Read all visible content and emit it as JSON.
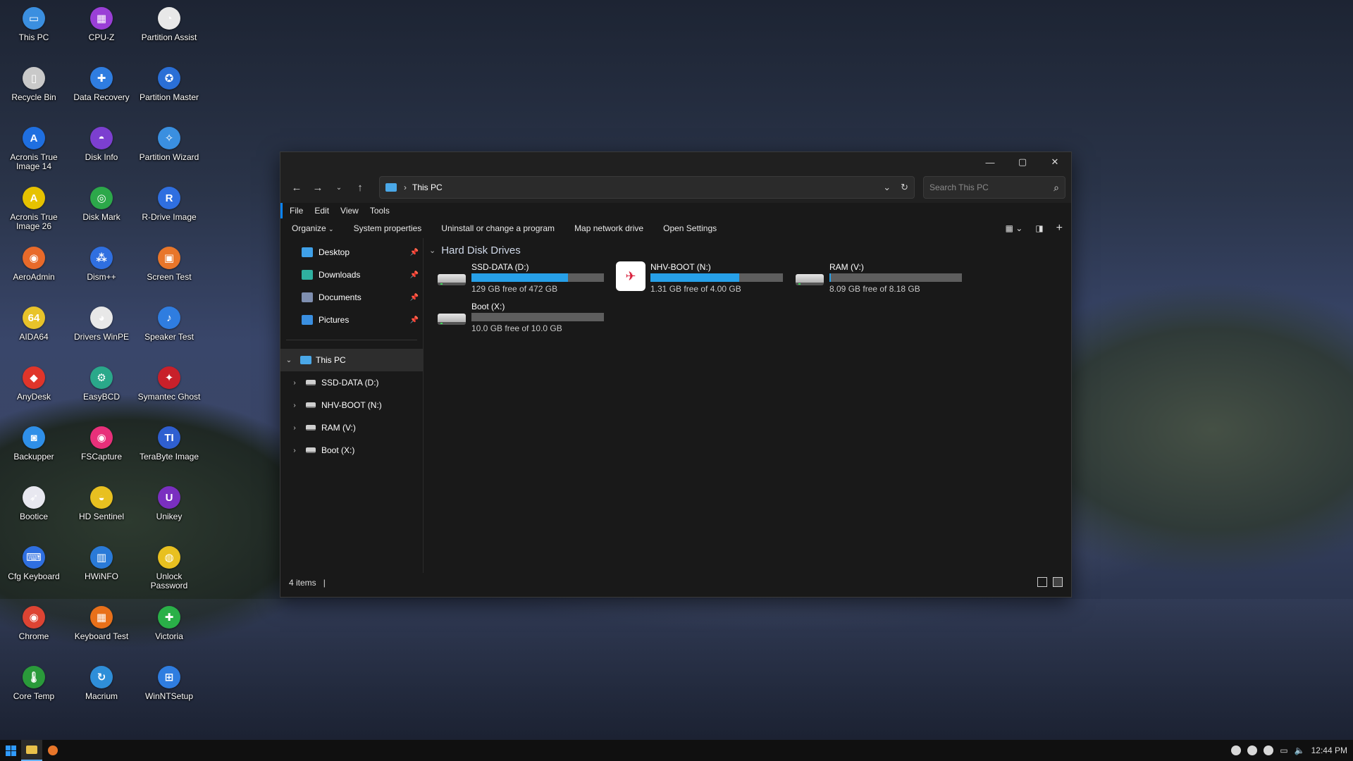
{
  "desktop": {
    "icons": [
      {
        "label": "This PC",
        "color": "#3b8fe0",
        "glyph": "▭"
      },
      {
        "label": "CPU-Z",
        "color": "#9a3fd6",
        "glyph": "▦"
      },
      {
        "label": "Partition Assist",
        "color": "#e8e8e8",
        "glyph": "◔"
      },
      {
        "label": "Recycle Bin",
        "color": "#c9c9c9",
        "glyph": "▯"
      },
      {
        "label": "Data Recovery",
        "color": "#2f7de0",
        "glyph": "✚"
      },
      {
        "label": "Partition Master",
        "color": "#2a6fd6",
        "glyph": "✪"
      },
      {
        "label": "Acronis True Image 14",
        "color": "#1f6fe0",
        "glyph": "A"
      },
      {
        "label": "Disk Info",
        "color": "#7c3fd0",
        "glyph": "◓"
      },
      {
        "label": "Partition Wizard",
        "color": "#3a8fe0",
        "glyph": "✧"
      },
      {
        "label": "Acronis True Image 26",
        "color": "#e6c200",
        "glyph": "A"
      },
      {
        "label": "Disk Mark",
        "color": "#2ca84a",
        "glyph": "◎"
      },
      {
        "label": "R-Drive Image",
        "color": "#2f6fe0",
        "glyph": "R"
      },
      {
        "label": "AeroAdmin",
        "color": "#e86a2a",
        "glyph": "◉"
      },
      {
        "label": "Dism++",
        "color": "#2f6fe0",
        "glyph": "⁂"
      },
      {
        "label": "Screen Test",
        "color": "#e8762a",
        "glyph": "▣"
      },
      {
        "label": "AIDA64",
        "color": "#e8c32a",
        "glyph": "64"
      },
      {
        "label": "Drivers WinPE",
        "color": "#e8e8e8",
        "glyph": "◕"
      },
      {
        "label": "Speaker Test",
        "color": "#2f7de0",
        "glyph": "♪"
      },
      {
        "label": "AnyDesk",
        "color": "#e0352a",
        "glyph": "◆"
      },
      {
        "label": "EasyBCD",
        "color": "#2aa88a",
        "glyph": "⚙"
      },
      {
        "label": "Symantec Ghost",
        "color": "#c8202a",
        "glyph": "✦"
      },
      {
        "label": "Backupper",
        "color": "#2f8fe8",
        "glyph": "◙"
      },
      {
        "label": "FSCapture",
        "color": "#e8307a",
        "glyph": "◉"
      },
      {
        "label": "TeraByte Image",
        "color": "#2f5fd0",
        "glyph": "TI"
      },
      {
        "label": "Bootice",
        "color": "#e8e8f0",
        "glyph": "➶"
      },
      {
        "label": "HD Sentinel",
        "color": "#e8c020",
        "glyph": "◒"
      },
      {
        "label": "Unikey",
        "color": "#7a2fc0",
        "glyph": "U"
      },
      {
        "label": "Cfg Keyboard",
        "color": "#2f6fe0",
        "glyph": "⌨"
      },
      {
        "label": "HWiNFO",
        "color": "#2a7ad8",
        "glyph": "▥"
      },
      {
        "label": "Unlock Password",
        "color": "#e8c020",
        "glyph": "◍"
      },
      {
        "label": "Chrome",
        "color": "#dd4433",
        "glyph": "◉"
      },
      {
        "label": "Keyboard Test",
        "color": "#e8701a",
        "glyph": "▦"
      },
      {
        "label": "Victoria",
        "color": "#2ab048",
        "glyph": "✚"
      },
      {
        "label": "Core Temp",
        "color": "#2a9a3a",
        "glyph": "🌡"
      },
      {
        "label": "Macrium",
        "color": "#2f8ed8",
        "glyph": "↻"
      },
      {
        "label": "WinNTSetup",
        "color": "#2f7de0",
        "glyph": "⊞"
      }
    ]
  },
  "explorer": {
    "address": {
      "path": "This PC"
    },
    "search": {
      "placeholder": "Search This PC"
    },
    "menu": [
      "File",
      "Edit",
      "View",
      "Tools"
    ],
    "commands": [
      "Organize",
      "System properties",
      "Uninstall or change a program",
      "Map network drive",
      "Open Settings"
    ],
    "quick_access": [
      {
        "label": "Desktop",
        "color": "#3fa0e8"
      },
      {
        "label": "Downloads",
        "color": "#2fb0a0"
      },
      {
        "label": "Documents",
        "color": "#7f8fb0"
      },
      {
        "label": "Pictures",
        "color": "#3a8fe0"
      }
    ],
    "tree": {
      "root": "This PC",
      "children": [
        "SSD-DATA (D:)",
        "NHV-BOOT (N:)",
        "RAM (V:)",
        "Boot (X:)"
      ]
    },
    "group_title": "Hard Disk Drives",
    "drives": [
      {
        "name": "SSD-DATA (D:)",
        "free_text": "129 GB free of 472 GB",
        "used_fraction": 0.727,
        "type": "hdd"
      },
      {
        "name": "NHV-BOOT (N:)",
        "free_text": "1.31 GB free of 4.00 GB",
        "used_fraction": 0.672,
        "type": "usb"
      },
      {
        "name": "RAM (V:)",
        "free_text": "8.09 GB free of 8.18 GB",
        "used_fraction": 0.011,
        "type": "hdd"
      },
      {
        "name": "Boot (X:)",
        "free_text": "10.0 GB free of 10.0 GB",
        "used_fraction": 0.0,
        "type": "hdd"
      }
    ],
    "status": {
      "items": "4 items"
    }
  },
  "taskbar": {
    "clock": "12:44 PM"
  }
}
